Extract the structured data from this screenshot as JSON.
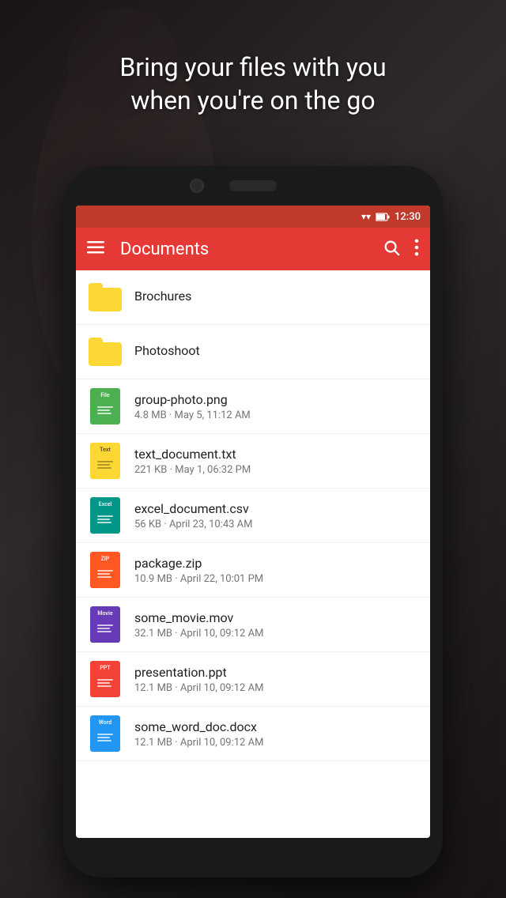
{
  "hero": {
    "text_line1": "Bring your files with you",
    "text_line2": "when you're on the go"
  },
  "status_bar": {
    "time": "12:30",
    "battery_icon": "🔋",
    "wifi_icon": "wifi"
  },
  "app_bar": {
    "title": "Documents",
    "menu_icon": "hamburger-menu",
    "search_icon": "search",
    "more_icon": "more-vertical"
  },
  "items": [
    {
      "type": "folder",
      "name": "Brochures",
      "meta": ""
    },
    {
      "type": "folder",
      "name": "Photoshoot",
      "meta": ""
    },
    {
      "type": "file",
      "icon_color": "#4CAF50",
      "icon_label": "File",
      "name": "group-photo.png",
      "meta": "4.8 MB · May 5, 11:12 AM"
    },
    {
      "type": "file",
      "icon_color": "#FDD835",
      "icon_label": "Text",
      "name": "text_document.txt",
      "meta": "221 KB · May 1, 06:32 PM"
    },
    {
      "type": "file",
      "icon_color": "#009688",
      "icon_label": "Excel",
      "name": "excel_document.csv",
      "meta": "56 KB · April 23, 10:43 AM"
    },
    {
      "type": "file",
      "icon_color": "#FF5722",
      "icon_label": "ZIP",
      "name": "package.zip",
      "meta": "10.9 MB · April 22, 10:01 PM"
    },
    {
      "type": "file",
      "icon_color": "#673AB7",
      "icon_label": "Movie",
      "name": "some_movie.mov",
      "meta": "32.1 MB · April 10, 09:12 AM"
    },
    {
      "type": "file",
      "icon_color": "#F44336",
      "icon_label": "PPT",
      "name": "presentation.ppt",
      "meta": "12.1 MB · April 10, 09:12 AM"
    },
    {
      "type": "file",
      "icon_color": "#2196F3",
      "icon_label": "Word",
      "name": "some_word_doc.docx",
      "meta": "12.1 MB · April 10, 09:12 AM"
    }
  ]
}
